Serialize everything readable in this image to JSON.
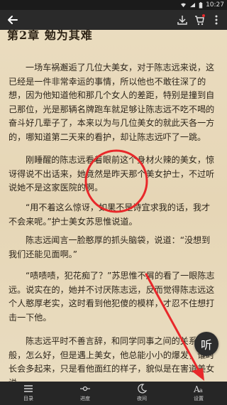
{
  "status": {
    "time": "10:27"
  },
  "reader": {
    "chapter_title": "第2章 勉为其难",
    "paragraphs": [
      "一场车祸邂逅了几位大美女，对于陈志远来说，这已经是一件非常幸运的事情，所以他也不敢往深了的想，因为他知道他和那几个女人的差距，特别是撞到自己那位，光是那辆名牌跑车就足够让陈志远不吃不喝的奋斗好几辈子了，本来以为与几位美女的就此天各一方的，哪知道第二天来的看护，却让陈志远吓了一跳。",
      "刚睡醒的陈志远看着眼前这个身材火辣的美女，惊讶得说不出话来，她竟然是昨天那个美女护士，不过听说她不是这家医院的啊。",
      "“用不着这么惊讶，如果不是诗宜求我的话，我才不会来呢。”护士美女苏思惟说道。",
      "陈志远闻言一脸憨厚的抓头脑袋，说道：“没想到我们还能见面啊。”",
      "“啧啧啧，犯花痴了？”苏思惟不屑的看了一眼陈志远。说实在的，她并不讨厌陈志远，反而觉得陈志远这个人憨厚老实，这时看到他犯傻的模样，才忍不住想打击一下他。",
      "陈志远平时不善言辞，和同学同事之间的关系都一般，怎么好，但是遇上美女，他总能小小的爆发，谁时长会多起来，只是看他面红的样子，貌似是在害道美女说"
    ]
  },
  "listen_label": "听",
  "bottom_nav": [
    {
      "label": "目录",
      "icon": "menu-icon"
    },
    {
      "label": "进度",
      "icon": "progress-icon"
    },
    {
      "label": "夜间",
      "icon": "moon-icon"
    },
    {
      "label": "设置",
      "icon": "font-settings-icon"
    }
  ],
  "colors": {
    "annotation": "#e8282a",
    "bar_dark": "#262626"
  }
}
